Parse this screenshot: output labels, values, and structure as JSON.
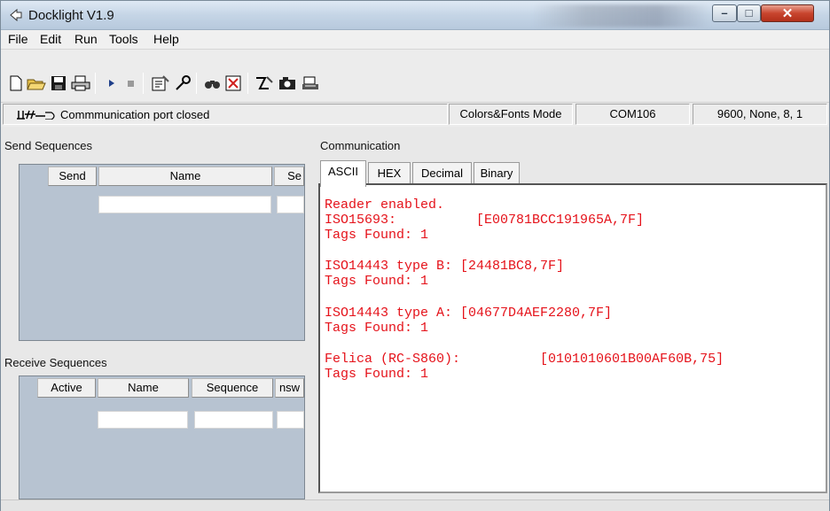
{
  "window": {
    "title": "Docklight V1.9"
  },
  "menu": [
    "File",
    "Edit",
    "Run",
    "Tools",
    "Help"
  ],
  "toolbar": {
    "icons": [
      "new-file-icon",
      "open-folder-icon",
      "save-icon",
      "print-icon",
      "play-icon",
      "stop-icon",
      "properties-icon",
      "keyboard-icon",
      "find-icon",
      "clear-icon",
      "script-icon",
      "snapshot-icon",
      "log-icon"
    ]
  },
  "status": {
    "message": "Commmunication port closed",
    "mode": "Colors&Fonts Mode",
    "port": "COM106",
    "settings": "9600, None, 8, 1"
  },
  "send_sequences": {
    "label": "Send Sequences",
    "columns": [
      "Send",
      "Name",
      "Se"
    ]
  },
  "receive_sequences": {
    "label": "Receive Sequences",
    "columns": [
      "Active",
      "Name",
      "Sequence",
      "nsw"
    ]
  },
  "communication": {
    "label": "Communication",
    "tabs": [
      "ASCII",
      "HEX",
      "Decimal",
      "Binary"
    ],
    "active_tab": "ASCII",
    "lines": [
      "Reader enabled.",
      "ISO15693:          [E00781BCC191965A,7F]",
      "Tags Found: 1",
      "",
      "ISO14443 type B: [24481BC8,7F]",
      "Tags Found: 1",
      "",
      "ISO14443 type A: [04677D4AEF2280,7F]",
      "Tags Found: 1",
      "",
      "Felica (RC-S860):          [0101010601B00AF60B,75]",
      "Tags Found: 1"
    ]
  },
  "colors": {
    "terminal_text": "#e5121a",
    "panel_bg": "#b7c3d1"
  }
}
